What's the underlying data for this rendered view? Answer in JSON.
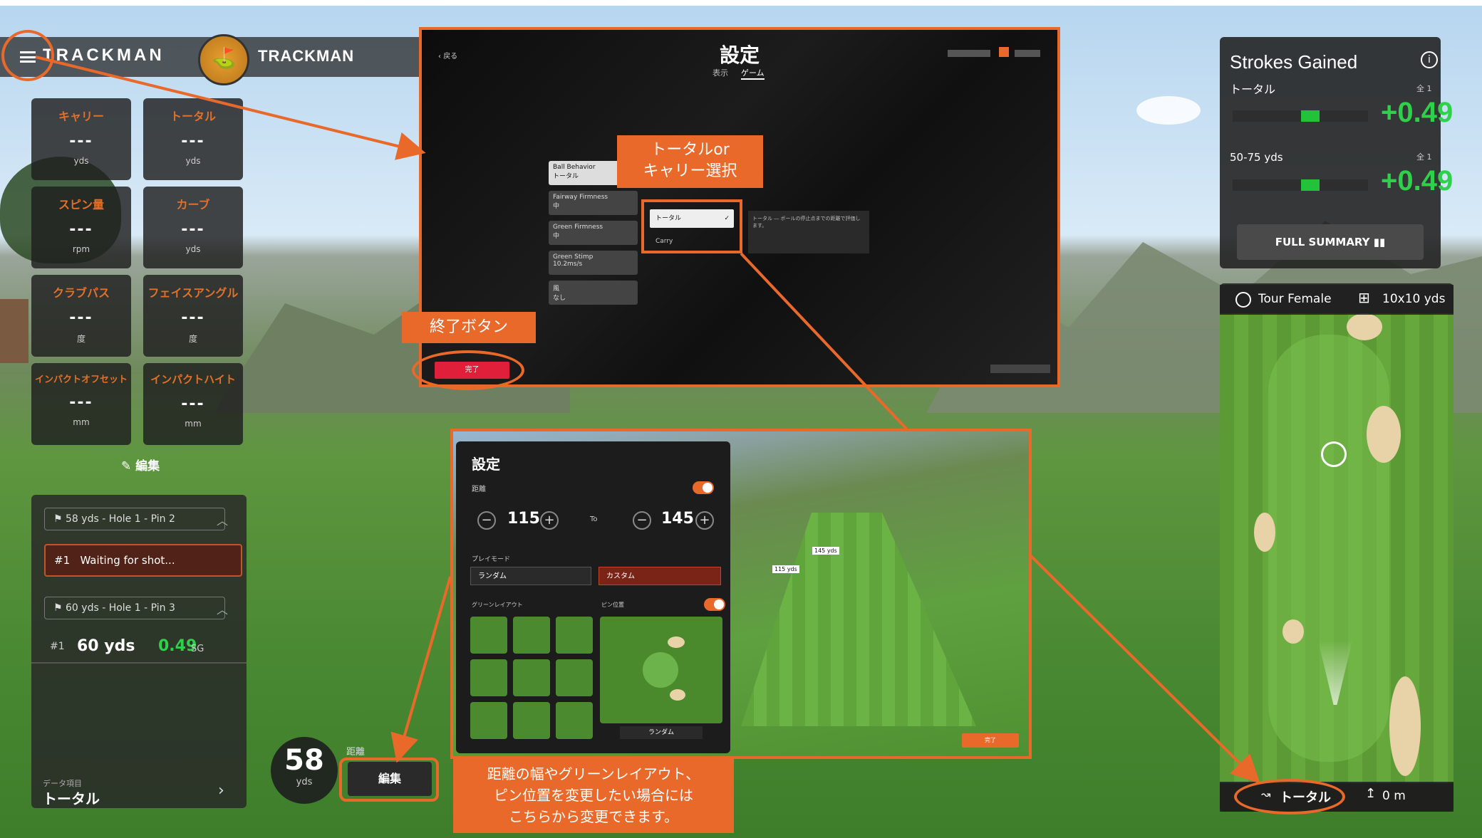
{
  "brand": {
    "left": "TRACKMAN",
    "right": "TRACKMAN"
  },
  "metrics": [
    {
      "label": "キャリー",
      "value": "---",
      "unit": "yds"
    },
    {
      "label": "トータル",
      "value": "---",
      "unit": "yds"
    },
    {
      "label": "スピン量",
      "value": "---",
      "unit": "rpm"
    },
    {
      "label": "カーブ",
      "value": "---",
      "unit": "yds"
    },
    {
      "label": "クラブパス",
      "value": "---",
      "unit": "度"
    },
    {
      "label": "フェイスアングル",
      "value": "---",
      "unit": "度"
    },
    {
      "label": "インパクトオフセット",
      "value": "---",
      "unit": "mm"
    },
    {
      "label": "インパクトハイト",
      "value": "---",
      "unit": "mm"
    }
  ],
  "edit_link": "編集",
  "shots": {
    "hole1": "58 yds - Hole 1 - Pin 2",
    "waiting": "Waiting for shot...",
    "waiting_num": "#1",
    "hole2": "60 yds - Hole 1 - Pin 3",
    "shot_num": "#1",
    "shot_dist": "60 yds",
    "shot_sg": "0.49",
    "shot_sg_unit": "SG",
    "data_label": "データ項目",
    "data_value": "トータル"
  },
  "distance_widget": {
    "value": "58",
    "unit": "yds",
    "label": "距離",
    "edit_button": "編集"
  },
  "settings_top": {
    "title": "設定",
    "tabs": [
      "表示",
      "ゲーム"
    ],
    "back": "戻る",
    "menu_items": [
      {
        "label": "Ball Behavior",
        "sub": "トータル"
      },
      {
        "label": "Fairway Firmness",
        "sub": "中"
      },
      {
        "label": "Green Firmness",
        "sub": "中"
      },
      {
        "label": "Green Stimp",
        "sub": "10.2ms/s"
      },
      {
        "label": "風",
        "sub": "なし"
      }
    ],
    "options": [
      "トータル",
      "Carry"
    ],
    "description": "トータル ― ボールの停止点までの距離で評価します。",
    "done_button": "完了"
  },
  "annotations": {
    "select": "トータルor\nキャリー選択",
    "exit": "終了ボタン",
    "bottom": "距離の幅やグリーンレイアウト、\nピン位置を変更したい場合には\nこちらから変更できます。"
  },
  "settings_bottom": {
    "title": "設定",
    "distance_label": "距離",
    "min": "115",
    "max": "145",
    "to": "To",
    "unit": "yds",
    "play_mode_label": "プレイモード",
    "modes": [
      "ランダム",
      "カスタム"
    ],
    "green_layout_label": "グリーンレイアウト",
    "pin_label": "ピン位置",
    "pin_value": "ランダム",
    "flag1": "145 yds",
    "flag2": "115 yds",
    "ok": "完了"
  },
  "strokes_gained": {
    "title": "Strokes Gained",
    "row1_label": "トータル",
    "row1_value": "+0.49",
    "row1_count": "全 1",
    "row2_label": "50-75 yds",
    "row2_value": "+0.49",
    "row2_count": "全 1",
    "full_summary": "FULL SUMMARY"
  },
  "map": {
    "player": "Tour Female",
    "grid": "10x10 yds",
    "mode": "トータル",
    "height": "0 m"
  },
  "colors": {
    "accent": "#e8692a",
    "positive": "#2fd04a",
    "panel": "#1c1c1c"
  }
}
